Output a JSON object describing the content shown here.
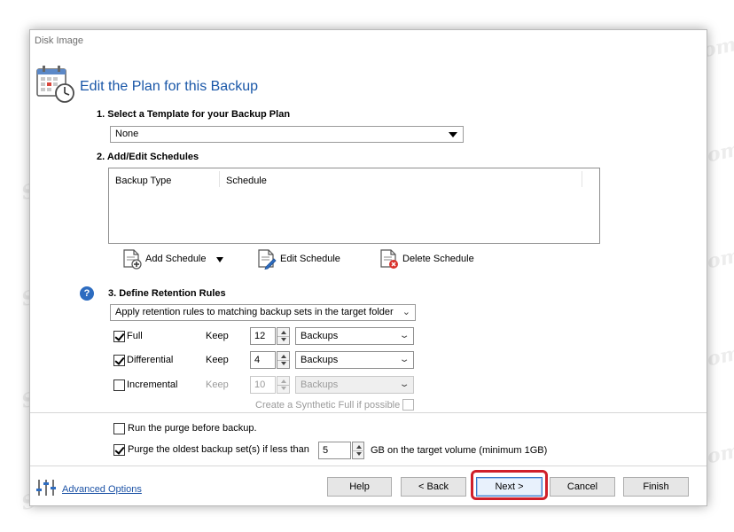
{
  "window": {
    "title": "Disk Image",
    "header_title": "Edit the Plan for this Backup"
  },
  "template_section": {
    "title": "1. Select a Template for your Backup Plan",
    "selected": "None"
  },
  "schedules_section": {
    "title": "2. Add/Edit Schedules",
    "columns": [
      "Backup Type",
      "Schedule"
    ],
    "add_label": "Add Schedule",
    "edit_label": "Edit Schedule",
    "delete_label": "Delete Schedule"
  },
  "retention_section": {
    "title": "3. Define Retention Rules",
    "help": "?",
    "rule_mode": "Apply retention rules to matching backup sets in the target folder",
    "rows": [
      {
        "label": "Full",
        "checked": true,
        "keep_label": "Keep",
        "value": "12",
        "unit": "Backups",
        "enabled": true
      },
      {
        "label": "Differential",
        "checked": true,
        "keep_label": "Keep",
        "value": "4",
        "unit": "Backups",
        "enabled": true
      },
      {
        "label": "Incremental",
        "checked": false,
        "keep_label": "Keep",
        "value": "10",
        "unit": "Backups",
        "enabled": false
      }
    ],
    "synthetic_full_label": "Create a Synthetic Full if possible",
    "run_purge_label": "Run the purge before backup.",
    "purge_oldest_label": "Purge the oldest backup set(s) if less than",
    "purge_value": "5",
    "purge_suffix": "GB on the target volume (minimum 1GB)"
  },
  "footer": {
    "advanced_options": "Advanced Options",
    "help": "Help",
    "back": "< Back",
    "next": "Next >",
    "cancel": "Cancel",
    "finish": "Finish"
  },
  "watermark_text": "Soringpcrepair.com",
  "colors": {
    "accent": "#1a57a8",
    "highlight": "#d0202a",
    "help_icon": "#2d6cc0"
  }
}
